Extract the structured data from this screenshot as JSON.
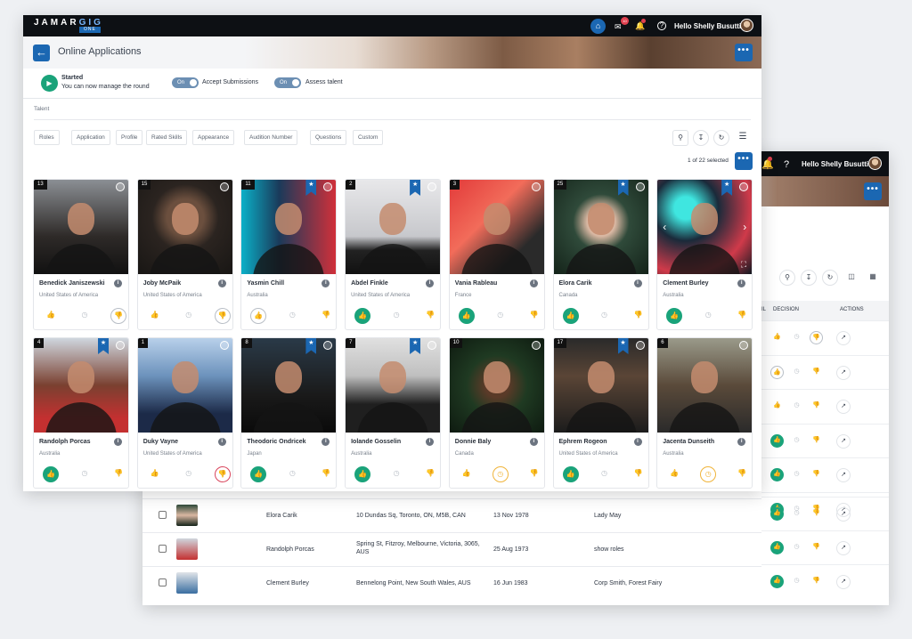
{
  "app": {
    "logo_main": "JAMAR",
    "logo_gig": "GIG",
    "logo_sub": "ONE"
  },
  "user": {
    "greeting": "Hello Shelly Busuttil",
    "notification_count": "10"
  },
  "page": {
    "title": "Online Applications"
  },
  "status": {
    "state": "Started",
    "message": "You can now manage the round",
    "toggle1": {
      "value": "On",
      "label": "Accept Submissions"
    },
    "toggle2": {
      "value": "On",
      "label": "Assess talent"
    }
  },
  "talent_label": "Talent",
  "filters": [
    "Roles",
    "Application",
    "Profile",
    "Rated Skills",
    "Appearance",
    "Audition Number",
    "Questions",
    "Custom"
  ],
  "selection": "1 of 22 selected",
  "cards": [
    {
      "num": "13",
      "name": "Benedick Janiszewski",
      "country": "United States of America",
      "decision": "dislike-ring",
      "ribbon": false,
      "photo": "p1"
    },
    {
      "num": "15",
      "name": "Joby McPaik",
      "country": "United States of America",
      "decision": "dislike-ring",
      "ribbon": false,
      "photo": "p2"
    },
    {
      "num": "11",
      "name": "Yasmin Chill",
      "country": "Australia",
      "decision": "like-ring",
      "ribbon": true,
      "photo": "p3"
    },
    {
      "num": "2",
      "name": "Abdel Finkle",
      "country": "United States of America",
      "decision": "like",
      "ribbon": true,
      "photo": "p4"
    },
    {
      "num": "3",
      "name": "Vania Rableau",
      "country": "France",
      "decision": "like",
      "ribbon": false,
      "photo": "p5"
    },
    {
      "num": "25",
      "name": "Elora Carik",
      "country": "Canada",
      "decision": "like",
      "ribbon": true,
      "photo": "p6"
    },
    {
      "num": "",
      "name": "Clement Burley",
      "country": "Australia",
      "decision": "like",
      "ribbon": true,
      "photo": "p7"
    },
    {
      "num": "4",
      "name": "Randolph Porcas",
      "country": "Australia",
      "decision": "like",
      "ribbon": true,
      "photo": "p8"
    },
    {
      "num": "1",
      "name": "Duky Vayne",
      "country": "United States of America",
      "decision": "dislike",
      "ribbon": false,
      "photo": "p9"
    },
    {
      "num": "8",
      "name": "Theodoric Ondricek",
      "country": "Japan",
      "decision": "like",
      "ribbon": true,
      "photo": "p10"
    },
    {
      "num": "7",
      "name": "Iolande Gosselin",
      "country": "Australia",
      "decision": "like",
      "ribbon": true,
      "photo": "p11"
    },
    {
      "num": "10",
      "name": "Donnie Baly",
      "country": "Canada",
      "decision": "maybe",
      "ribbon": false,
      "photo": "p12"
    },
    {
      "num": "17",
      "name": "Ephrem Rogeon",
      "country": "United States of America",
      "decision": "like",
      "ribbon": true,
      "photo": "p13"
    },
    {
      "num": "6",
      "name": "Jacenta Dunseith",
      "country": "Australia",
      "decision": "maybe",
      "ribbon": false,
      "photo": "p14"
    }
  ],
  "back": {
    "greeting": "Hello Shelly Busuttil",
    "col_decision": "DECISION",
    "col_actions": "ACTIONS",
    "col_cut": "IL",
    "decisions": [
      "plain",
      "ring",
      "plain",
      "like",
      "like",
      "like",
      "like",
      "like",
      "like"
    ],
    "rows": [
      {
        "name": "Elora Carik",
        "address": "10 Dundas Sq, Toronto, ON, M5B, CAN",
        "dob": "13 Nov 1978",
        "role": "Lady May"
      },
      {
        "name": "Randolph Porcas",
        "address": "Spring St, Fitzroy, Melbourne, Victoria, 3065, AUS",
        "dob": "25 Aug 1973",
        "role": "show roles"
      },
      {
        "name": "Clement Burley",
        "address": "Bennelong Point, New South Wales, AUS",
        "dob": "16 Jun 1983",
        "role": "Corp Smith, Forest Fairy"
      }
    ]
  }
}
